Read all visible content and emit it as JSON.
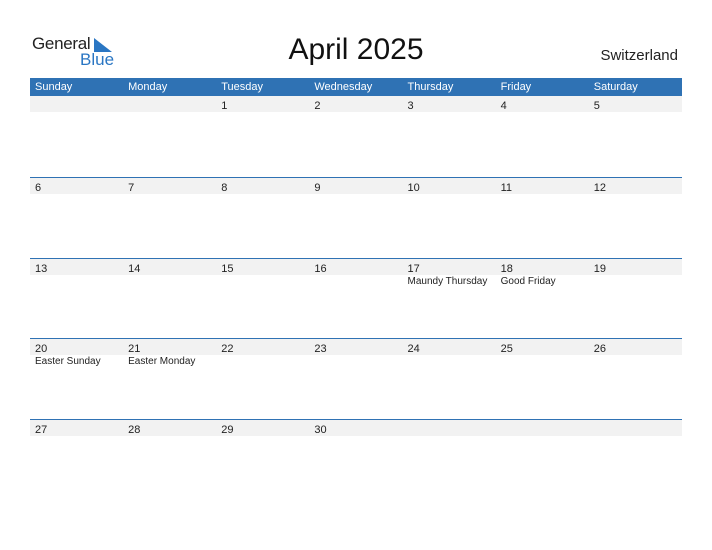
{
  "logo": {
    "word1": "General",
    "word2": "Blue",
    "brand_color": "#2a76c3"
  },
  "title": "April 2025",
  "country": "Switzerland",
  "header_color": "#2f72b4",
  "weekdays": [
    "Sunday",
    "Monday",
    "Tuesday",
    "Wednesday",
    "Thursday",
    "Friday",
    "Saturday"
  ],
  "weeks": [
    {
      "days": [
        {
          "n": ""
        },
        {
          "n": ""
        },
        {
          "n": "1"
        },
        {
          "n": "2"
        },
        {
          "n": "3"
        },
        {
          "n": "4"
        },
        {
          "n": "5"
        }
      ]
    },
    {
      "days": [
        {
          "n": "6"
        },
        {
          "n": "7"
        },
        {
          "n": "8"
        },
        {
          "n": "9"
        },
        {
          "n": "10"
        },
        {
          "n": "11"
        },
        {
          "n": "12"
        }
      ]
    },
    {
      "days": [
        {
          "n": "13"
        },
        {
          "n": "14"
        },
        {
          "n": "15"
        },
        {
          "n": "16"
        },
        {
          "n": "17",
          "h": "Maundy Thursday"
        },
        {
          "n": "18",
          "h": "Good Friday"
        },
        {
          "n": "19"
        }
      ]
    },
    {
      "days": [
        {
          "n": "20",
          "h": "Easter Sunday"
        },
        {
          "n": "21",
          "h": "Easter Monday"
        },
        {
          "n": "22"
        },
        {
          "n": "23"
        },
        {
          "n": "24"
        },
        {
          "n": "25"
        },
        {
          "n": "26"
        }
      ]
    },
    {
      "days": [
        {
          "n": "27"
        },
        {
          "n": "28"
        },
        {
          "n": "29"
        },
        {
          "n": "30"
        },
        {
          "n": ""
        },
        {
          "n": ""
        },
        {
          "n": ""
        }
      ]
    }
  ]
}
